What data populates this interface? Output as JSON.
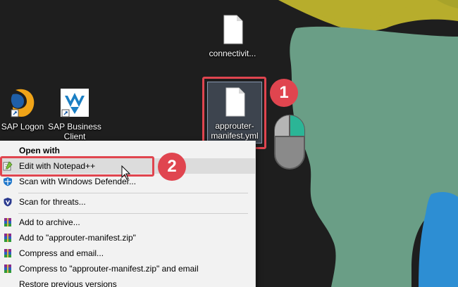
{
  "desktop": {
    "icons": {
      "connectivity": {
        "label": "connectivit..."
      },
      "approuter": {
        "label": "approuter-manifest.yml"
      },
      "sap_logon": {
        "label": "SAP Logon"
      },
      "sap_business_client": {
        "label": "SAP Business Client"
      }
    }
  },
  "annotations": {
    "step1": "1",
    "step2": "2",
    "accent_color": "#e0454f"
  },
  "context_menu": {
    "items": [
      {
        "label": "Open with",
        "icon": "",
        "bold": true
      },
      {
        "label": "Edit with Notepad++",
        "icon": "notepad-plus-plus-icon",
        "highlighted": true
      },
      {
        "label": "Scan with Windows Defender...",
        "icon": "windows-defender-icon"
      },
      {
        "label": "Scan for threats...",
        "icon": "shield-icon"
      },
      {
        "label": "Add to archive...",
        "icon": "winrar-icon"
      },
      {
        "label": "Add to \"approuter-manifest.zip\"",
        "icon": "winrar-icon"
      },
      {
        "label": "Compress and email...",
        "icon": "winrar-icon"
      },
      {
        "label": "Compress to \"approuter-manifest.zip\" and email",
        "icon": "winrar-icon"
      },
      {
        "label": "Restore previous versions",
        "icon": ""
      }
    ]
  },
  "colors": {
    "desktop_bg": "#1e1e1e",
    "land_olive": "#b7ad2c",
    "land_green": "#6a9e86",
    "ocean_blue": "#2d8ed3",
    "menu_bg": "#f2f2f2"
  }
}
